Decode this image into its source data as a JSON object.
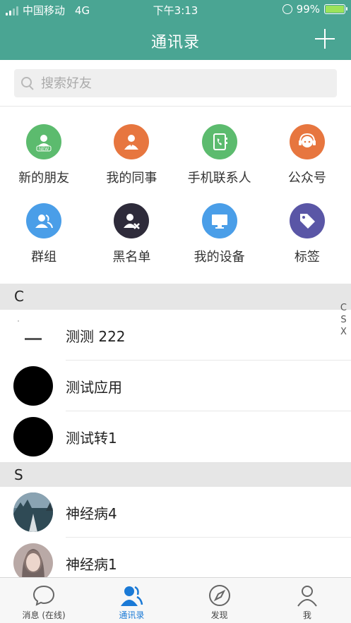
{
  "status_bar": {
    "carrier": "中国移动",
    "network": "4G",
    "time": "下午3:13",
    "battery": "99%"
  },
  "nav": {
    "title": "通讯录"
  },
  "search": {
    "placeholder": "搜索好友"
  },
  "shortcuts": [
    {
      "label": "新的朋友",
      "icon": "new-friend-icon",
      "color": "#5cbb6e"
    },
    {
      "label": "我的同事",
      "icon": "colleague-icon",
      "color": "#e7763f"
    },
    {
      "label": "手机联系人",
      "icon": "phone-contacts-icon",
      "color": "#5cbb6e"
    },
    {
      "label": "公众号",
      "icon": "official-account-icon",
      "color": "#e7763f"
    },
    {
      "label": "群组",
      "icon": "group-icon",
      "color": "#4a9ee8"
    },
    {
      "label": "黑名单",
      "icon": "blacklist-icon",
      "color": "#2e2b3a"
    },
    {
      "label": "我的设备",
      "icon": "device-icon",
      "color": "#4a9ee8"
    },
    {
      "label": "标签",
      "icon": "tag-icon",
      "color": "#5a56a6"
    }
  ],
  "sections": [
    {
      "letter": "C",
      "contacts": [
        {
          "name": "测测 222",
          "avatar": "document-thumbnail"
        },
        {
          "name": "测试应用",
          "avatar": "black-circle"
        },
        {
          "name": "测试转1",
          "avatar": "black-circle"
        }
      ]
    },
    {
      "letter": "S",
      "contacts": [
        {
          "name": "神经病4",
          "avatar": "photo-night-road"
        },
        {
          "name": "神经病1",
          "avatar": "photo-portrait"
        }
      ]
    }
  ],
  "index_letters": [
    "C",
    "S",
    "X"
  ],
  "tabs": [
    {
      "label": "消息 (在线)",
      "icon": "chat-bubble-icon",
      "active": false
    },
    {
      "label": "通讯录",
      "icon": "contacts-icon",
      "active": true
    },
    {
      "label": "发现",
      "icon": "compass-icon",
      "active": false
    },
    {
      "label": "我",
      "icon": "profile-icon",
      "active": false
    }
  ],
  "colors": {
    "header": "#4aa593",
    "active_tab": "#1b7ad6",
    "section_bg": "#e6e6e6"
  }
}
